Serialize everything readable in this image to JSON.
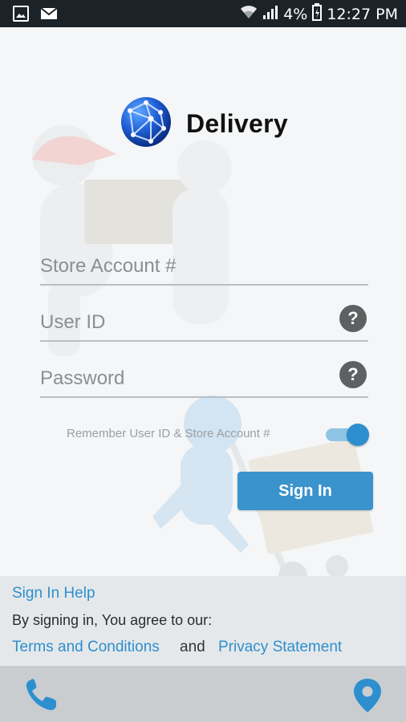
{
  "status_bar": {
    "battery": "4%",
    "time": "12:27 PM",
    "icons": [
      "image-icon",
      "mail-icon",
      "wifi-icon",
      "signal-icon",
      "battery-icon"
    ]
  },
  "brand": {
    "title": "Delivery",
    "logo": "globe-network-logo"
  },
  "form": {
    "store_account_placeholder": "Store Account #",
    "user_id_placeholder": "User ID",
    "password_placeholder": "Password",
    "help_symbol": "?",
    "remember_label": "Remember User ID & Store Account #",
    "remember_on": true,
    "sign_in_label": "Sign In"
  },
  "footer": {
    "sign_in_help": "Sign In Help",
    "agree_text": "By signing in, You agree to our:",
    "terms": "Terms and Conditions",
    "and_text": "and",
    "privacy": "Privacy Statement"
  },
  "bottom_bar": {
    "icons": [
      "phone-icon",
      "location-pin-icon"
    ]
  },
  "colors": {
    "accent": "#2e8fcf",
    "button": "#3a93cc",
    "status_bar": "#1b2328",
    "bottom_bar": "#c9cdd0"
  }
}
